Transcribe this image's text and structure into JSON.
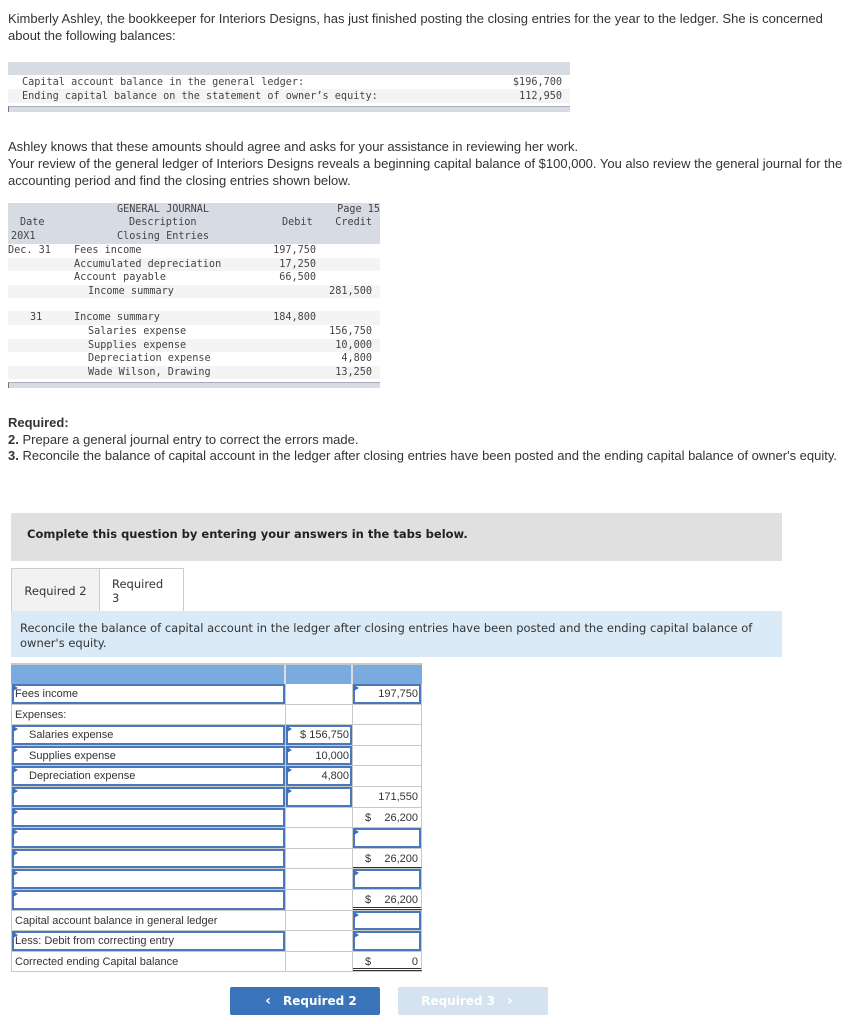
{
  "intro": {
    "text": "Kimberly Ashley, the bookkeeper for Interiors Designs, has just finished posting the closing entries for the year to the ledger. She is concerned about the following balances:"
  },
  "balances": {
    "rows": [
      {
        "label": "Capital account balance in the general ledger:",
        "value": "$196,700"
      },
      {
        "label": "Ending capital balance on the statement of owner’s equity:",
        "value": "112,950"
      }
    ]
  },
  "paragraph2": {
    "line1": "Ashley knows that these amounts should agree and asks for your assistance in reviewing her work.",
    "line2": "Your review of the general ledger of Interiors Designs reveals a beginning capital balance of $100,000. You also review the general journal for the accounting period and find the closing entries shown below."
  },
  "journal": {
    "title": "GENERAL JOURNAL",
    "page": "Page 15",
    "headers": {
      "date": "Date",
      "description": "Description",
      "debit": "Debit",
      "credit": "Credit"
    },
    "year": "20X1",
    "subtitle": "Closing Entries",
    "entry1": [
      {
        "date": "Dec. 31",
        "description": "Fees income",
        "indent": false,
        "debit": "197,750",
        "credit": ""
      },
      {
        "date": "",
        "description": "Accumulated depreciation",
        "indent": false,
        "debit": "17,250",
        "credit": ""
      },
      {
        "date": "",
        "description": "Account payable",
        "indent": false,
        "debit": "66,500",
        "credit": ""
      },
      {
        "date": "",
        "description": "Income summary",
        "indent": true,
        "debit": "",
        "credit": "281,500"
      }
    ],
    "entry2": [
      {
        "date": "31",
        "description": "Income summary",
        "indent": false,
        "debit": "184,800",
        "credit": ""
      },
      {
        "date": "",
        "description": "Salaries expense",
        "indent": true,
        "debit": "",
        "credit": "156,750"
      },
      {
        "date": "",
        "description": "Supplies expense",
        "indent": true,
        "debit": "",
        "credit": "10,000"
      },
      {
        "date": "",
        "description": "Depreciation expense",
        "indent": true,
        "debit": "",
        "credit": "4,800"
      },
      {
        "date": "",
        "description": "Wade Wilson, Drawing",
        "indent": true,
        "debit": "",
        "credit": "13,250"
      }
    ]
  },
  "required": {
    "heading": "Required:",
    "item2_num": "2.",
    "item2_text": " Prepare a general journal entry to correct the errors made.",
    "item3_num": "3.",
    "item3_text": " Reconcile the balance of capital account in the ledger after closing entries have been posted and the ending capital balance of owner's equity."
  },
  "complete_banner": "Complete this question by entering your answers in the tabs below.",
  "tabs": [
    {
      "label": "Required 2",
      "active": false
    },
    {
      "label": "Required 3",
      "active": true
    }
  ],
  "instruction": "Reconcile the balance of capital account in the ledger after closing entries have been posted and the ending capital balance of owner's equity.",
  "answer_table": {
    "rows": [
      {
        "label": "Fees income",
        "col2": "",
        "col3": "197,750"
      },
      {
        "label": "Expenses:",
        "col2": "",
        "col3": ""
      },
      {
        "label": "Salaries expense",
        "col2_prefix": "$",
        "col2": "156,750",
        "col3": ""
      },
      {
        "label": "Supplies expense",
        "col2": "10,000",
        "col3": ""
      },
      {
        "label": "Depreciation expense",
        "col2": "4,800",
        "col3": ""
      },
      {
        "label": "",
        "col2": "",
        "col3": "171,550"
      },
      {
        "label": "",
        "col2": "",
        "col3_prefix": "$",
        "col3": "26,200"
      },
      {
        "label": "",
        "col2": "",
        "col3": ""
      },
      {
        "label": "",
        "col2": "",
        "col3_prefix": "$",
        "col3": "26,200"
      },
      {
        "label": "",
        "col2": "",
        "col3": ""
      },
      {
        "label": "",
        "col2": "",
        "col3_prefix": "$",
        "col3": "26,200"
      },
      {
        "label": "Capital account balance in general ledger",
        "col2": "",
        "col3": ""
      },
      {
        "label": "Less: Debit from correcting entry",
        "col2": "",
        "col3": ""
      },
      {
        "label": "Corrected ending Capital balance",
        "col2": "",
        "col3_prefix": "$",
        "col3": "0"
      }
    ]
  },
  "nav": {
    "prev_label": "Required 2",
    "next_label": "Required 3",
    "prev_icon": "chevron-left-icon",
    "next_icon": "chevron-right-icon"
  }
}
